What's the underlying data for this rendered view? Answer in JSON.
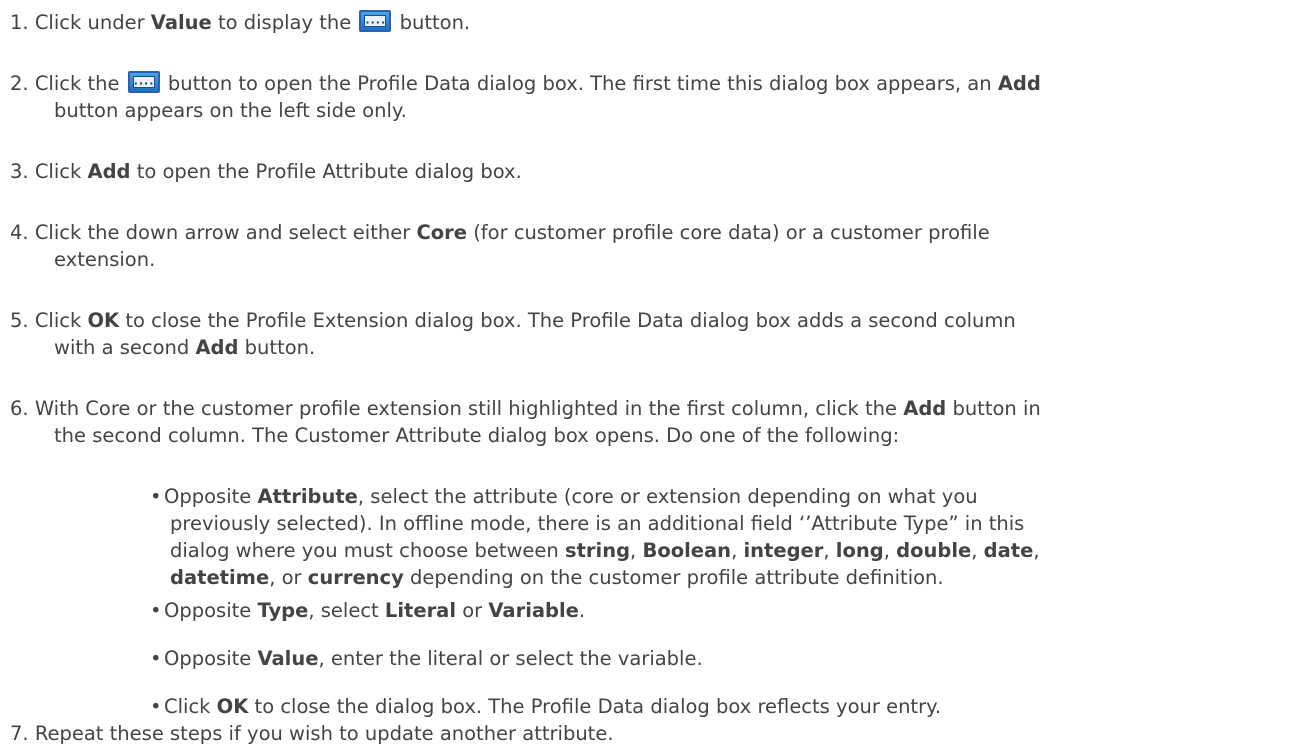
{
  "steps": [
    {
      "num": "1.",
      "t1": "Click under ",
      "b1": "Value",
      "t2": " to display the ",
      "t3": " button."
    },
    {
      "num": "2.",
      "t1": "Click the ",
      "t2": " button to open the Profile Data dialog box.  The first time this dialog box appears, an ",
      "b1": "Add",
      "t3": "button appears  on the left side only."
    },
    {
      "num": "3.",
      "t1": "Click ",
      "b1": "Add",
      "t2": "  to open the Profile Attribute dialog box."
    },
    {
      "num": "4.",
      "t1": "Click the down arrow and select either ",
      "b1": "Core",
      "t2": " (for customer profile core data) or a customer profile",
      "t3": "extension."
    },
    {
      "num": "5.",
      "t1": "Click ",
      "b1": "OK",
      "t2": " to close the Profile Extension dialog box. The Profile Data dialog box adds a second column",
      "t3": "with a second ",
      "b2": "Add",
      "t4": " button."
    },
    {
      "num": "6.",
      "t1": "With Core or the customer profile extension still highlighted in the first column, click the ",
      "b1": "Add",
      "t2": " button in",
      "t3": "the second column. The Customer Attribute dialog box opens. Do one of the following:"
    },
    {
      "num": "7.",
      "t1": "Repeat these steps if you wish to update another attribute."
    }
  ],
  "bullets": [
    {
      "t1": "Opposite ",
      "b1": "Attribute",
      "t2": ", select the attribute (core or extension depending on what you",
      "t3": "previously selected). In offline mode, there is an additional field ‘’Attribute Type” in this",
      "t4": "dialog where you must choose between ",
      "b_string": "string",
      "sep1": ", ",
      "b_boolean": "Boolean",
      "sep2": ", ",
      "b_integer": "integer",
      "sep3": ", ",
      "b_long": "long",
      "sep4": ", ",
      "b_double": "double",
      "sep5": ", ",
      "b_date": "date",
      "sep6": ",",
      "b_datetime": "datetime",
      "t5": ", or ",
      "b_currency": "currency",
      "t6": " depending on the customer profile attribute definition."
    },
    {
      "t1": "Opposite ",
      "b1": "Type",
      "t2": ", select ",
      "b2": "Literal",
      "t3": " or ",
      "b3": "Variable",
      "t4": "."
    },
    {
      "t1": "Opposite ",
      "b1": "Value",
      "t2": ", enter the literal or select the variable."
    },
    {
      "t1": "Click ",
      "b1": "OK",
      "t2": " to close the dialog box. The Profile Data dialog box reflects your entry."
    }
  ],
  "icons": {
    "ellipsis_button": "ellipsis-button-icon",
    "bullet": "bullet-icon"
  },
  "colors": {
    "text": "#444444",
    "icon_blue": "#1f6fc8"
  }
}
